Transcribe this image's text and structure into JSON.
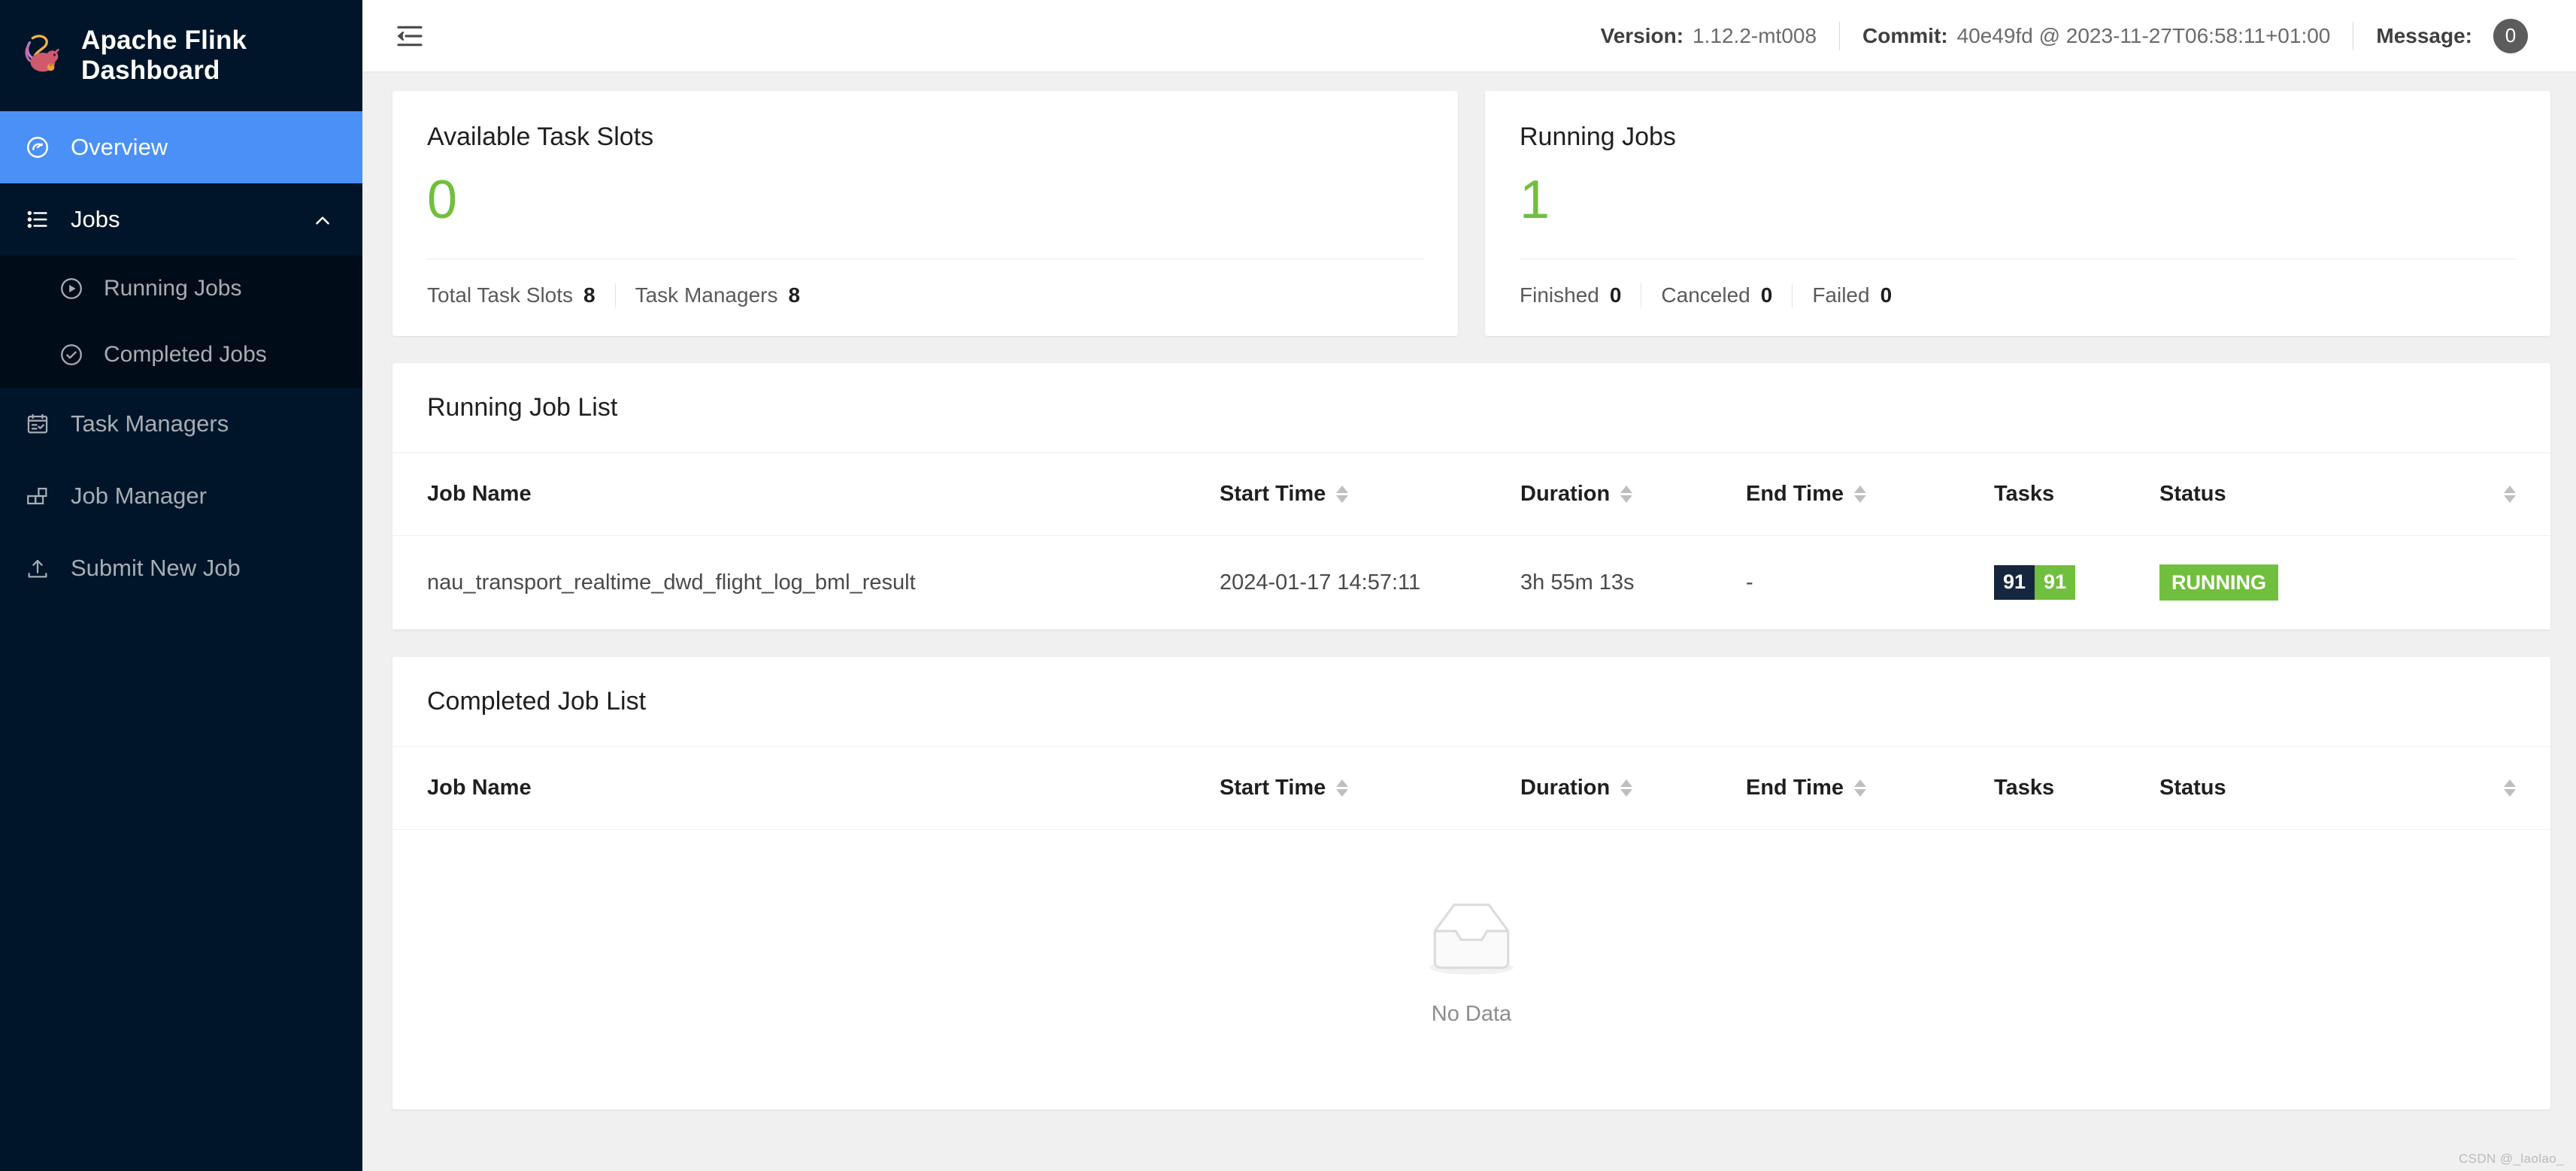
{
  "brand": {
    "title": "Apache Flink Dashboard",
    "logo_icon": "flink-squirrel-logo"
  },
  "sidebar": {
    "items": [
      {
        "label": "Overview",
        "icon": "dashboard-icon",
        "active": true
      },
      {
        "label": "Jobs",
        "icon": "list-icon",
        "expanded": true,
        "chevron": "chevron-up-icon"
      },
      {
        "label": "Running Jobs",
        "icon": "play-circle-icon",
        "sub": true
      },
      {
        "label": "Completed Jobs",
        "icon": "check-circle-icon",
        "sub": true
      },
      {
        "label": "Task Managers",
        "icon": "schedule-icon"
      },
      {
        "label": "Job Manager",
        "icon": "layout-block-icon"
      },
      {
        "label": "Submit New Job",
        "icon": "upload-icon"
      }
    ]
  },
  "topbar": {
    "fold_icon": "menu-fold-icon",
    "version_label": "Version:",
    "version_value": "1.12.2-mt008",
    "commit_label": "Commit:",
    "commit_value": "40e49fd @ 2023-11-27T06:58:11+01:00",
    "message_label": "Message:",
    "message_count": "0"
  },
  "stats": [
    {
      "title": "Available Task Slots",
      "value": "0",
      "value_color": "#71bf3e",
      "footer": [
        {
          "label": "Total Task Slots",
          "value": "8"
        },
        {
          "label": "Task Managers",
          "value": "8"
        }
      ]
    },
    {
      "title": "Running Jobs",
      "value": "1",
      "value_color": "#71bf3e",
      "footer": [
        {
          "label": "Finished",
          "value": "0"
        },
        {
          "label": "Canceled",
          "value": "0"
        },
        {
          "label": "Failed",
          "value": "0"
        }
      ]
    }
  ],
  "running_list": {
    "title": "Running Job List",
    "columns": [
      "Job Name",
      "Start Time",
      "Duration",
      "End Time",
      "Tasks",
      "Status"
    ],
    "rows": [
      {
        "job_name": "nau_transport_realtime_dwd_flight_log_bml_result",
        "start_time": "2024-01-17 14:57:11",
        "duration": "3h 55m 13s",
        "end_time": "-",
        "tasks_total": "91",
        "tasks_running": "91",
        "status": "RUNNING"
      }
    ]
  },
  "completed_list": {
    "title": "Completed Job List",
    "columns": [
      "Job Name",
      "Start Time",
      "Duration",
      "End Time",
      "Tasks",
      "Status"
    ],
    "rows": [],
    "empty_text": "No Data",
    "empty_icon": "empty-inbox-icon"
  },
  "watermark": "CSDN @_laolao_"
}
